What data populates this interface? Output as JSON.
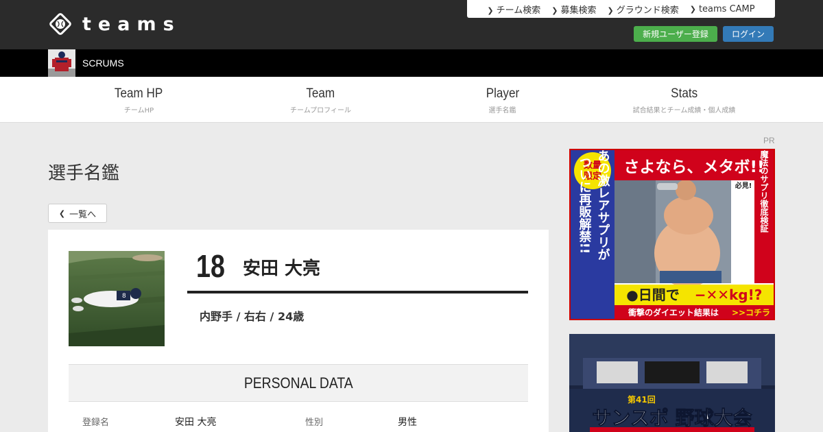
{
  "header": {
    "logo_text": "teams",
    "nav": [
      {
        "label": "チーム検索"
      },
      {
        "label": "募集検索"
      },
      {
        "label": "グラウンド検索"
      },
      {
        "label": "teams CAMP"
      }
    ],
    "register_label": "新規ユーザー登録",
    "login_label": "ログイン"
  },
  "team": {
    "name": "SCRUMS"
  },
  "mainnav": [
    {
      "en": "Team HP",
      "ja": "チームHP"
    },
    {
      "en": "Team",
      "ja": "チームプロフィール"
    },
    {
      "en": "Player",
      "ja": "選手名鑑"
    },
    {
      "en": "Stats",
      "ja": "試合結果とチーム成績・個人成績"
    }
  ],
  "page": {
    "title": "選手名鑑",
    "back_label": "一覧へ"
  },
  "player": {
    "number": "18",
    "name": "安田 大亮",
    "meta": "内野手 / 右右 / 24歳"
  },
  "personal_data": {
    "heading": "PERSONAL DATA",
    "rows": [
      {
        "label": "登録名",
        "value": "安田 大亮"
      },
      {
        "label": "性別",
        "value": "男性"
      }
    ]
  },
  "sidebar": {
    "pr_label": "PR",
    "ad1": {
      "headline": "さよなら、メタボ!!",
      "badge": "数量限定",
      "vertical_left": "あの激レアサプリがついに再販解禁!!",
      "vertical_right": "必見!魔法のサプリ徹底検証",
      "days": "●日間で",
      "result": "−✕✕kg!?",
      "footer": "衝撃のダイエット結果は",
      "footer_link": ">>コチラ"
    },
    "ad2": {
      "edition": "第41回",
      "title": "サンスポ 野球大会"
    }
  },
  "colors": {
    "header_bg": "#2b2b2b",
    "teambar_bg": "#000000",
    "register_btn": "#4cae4c",
    "login_btn": "#337ab7",
    "page_bg": "#ebebeb"
  }
}
